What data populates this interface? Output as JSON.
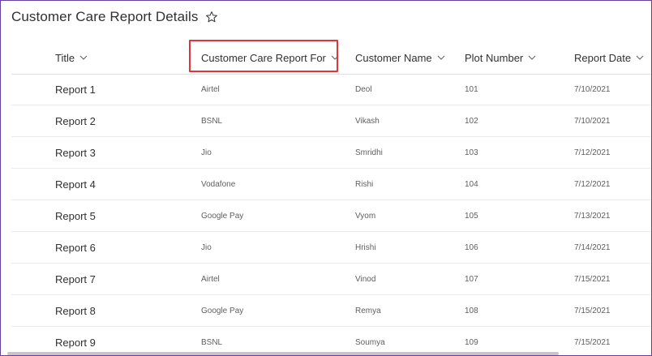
{
  "page": {
    "title": "Customer Care Report Details",
    "favorite_icon": "star-outline-icon"
  },
  "columns": [
    {
      "key": "title",
      "label": "Title"
    },
    {
      "key": "report_for",
      "label": "Customer Care Report For",
      "highlighted": true
    },
    {
      "key": "customer_name",
      "label": "Customer Name"
    },
    {
      "key": "plot_number",
      "label": "Plot Number"
    },
    {
      "key": "report_date",
      "label": "Report Date"
    }
  ],
  "rows": [
    {
      "title": "Report 1",
      "report_for": "Airtel",
      "customer_name": "Deol",
      "plot_number": "101",
      "report_date": "7/10/2021"
    },
    {
      "title": "Report 2",
      "report_for": "BSNL",
      "customer_name": "Vikash",
      "plot_number": "102",
      "report_date": "7/10/2021"
    },
    {
      "title": "Report 3",
      "report_for": "Jio",
      "customer_name": "Smridhi",
      "plot_number": "103",
      "report_date": "7/12/2021"
    },
    {
      "title": "Report 4",
      "report_for": "Vodafone",
      "customer_name": "Rishi",
      "plot_number": "104",
      "report_date": "7/12/2021"
    },
    {
      "title": "Report 5",
      "report_for": "Google Pay",
      "customer_name": "Vyom",
      "plot_number": "105",
      "report_date": "7/13/2021"
    },
    {
      "title": "Report 6",
      "report_for": "Jio",
      "customer_name": "Hrishi",
      "plot_number": "106",
      "report_date": "7/14/2021"
    },
    {
      "title": "Report 7",
      "report_for": "Airtel",
      "customer_name": "Vinod",
      "plot_number": "107",
      "report_date": "7/15/2021"
    },
    {
      "title": "Report 8",
      "report_for": "Google Pay",
      "customer_name": "Remya",
      "plot_number": "108",
      "report_date": "7/15/2021"
    },
    {
      "title": "Report 9",
      "report_for": "BSNL",
      "customer_name": "Soumya",
      "plot_number": "109",
      "report_date": "7/15/2021"
    }
  ],
  "colors": {
    "frame_border": "#6b3fa0",
    "highlight_border": "#e0353a",
    "text_primary": "#323130",
    "text_secondary": "#605e5c"
  }
}
